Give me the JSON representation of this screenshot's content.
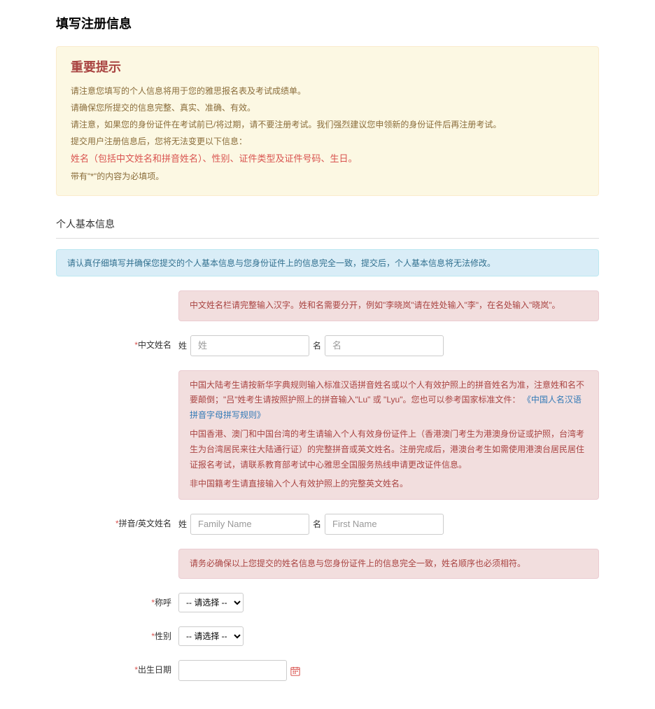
{
  "page": {
    "title": "填写注册信息"
  },
  "important": {
    "title": "重要提示",
    "line1": "请注意您填写的个人信息将用于您的雅思报名表及考试成绩单。",
    "line2": "请确保您所提交的信息完整、真实、准确、有效。",
    "line3": "请注意，如果您的身份证件在考试前已/将过期，请不要注册考试。我们强烈建议您申领新的身份证件后再注册考试。",
    "line4": "提交用户注册信息后，您将无法变更以下信息：",
    "line5": "姓名（包括中文姓名和拼音姓名）、性别、证件类型及证件号码、生日。",
    "line6": "带有\"*\"的内容为必填项。"
  },
  "section": {
    "title": "个人基本信息"
  },
  "info_alert": "请认真仔细填写并确保您提交的个人基本信息与您身份证件上的信息完全一致，提交后，个人基本信息将无法修改。",
  "hints": {
    "chinese_name": "中文姓名栏请完整输入汉字。姓和名需要分开，例如\"李晓岚\"请在姓处输入\"李\"，在名处输入\"晓岚\"。",
    "pinyin_p1_a": "中国大陆考生请按新华字典规则输入标准汉语拼音姓名或以个人有效护照上的拼音姓名为准，注意姓和名不要颠倒；\"吕\"姓考生请按照护照上的拼音输入\"Lu\" 或 \"Lyu\"。您也可以参考国家标准文件：",
    "pinyin_p1_link": "《中国人名汉语拼音字母拼写规则》",
    "pinyin_p2": "中国香港、澳门和中国台湾的考生请输入个人有效身份证件上（香港澳门考生为港澳身份证或护照，台湾考生为台湾居民来往大陆通行证）的完整拼音或英文姓名。注册完成后，港澳台考生如需使用港澳台居民居住证报名考试，请联系教育部考试中心雅思全国服务热线申请更改证件信息。",
    "pinyin_p3": "非中国籍考生请直接输入个人有效护照上的完整英文姓名。",
    "consistency": "请务必确保以上您提交的姓名信息与您身份证件上的信息完全一致，姓名顺序也必须相符。"
  },
  "fields": {
    "chinese_name_label": "中文姓名",
    "family_sub": "姓",
    "given_sub": "名",
    "chinese_family_placeholder": "姓",
    "chinese_given_placeholder": "名",
    "pinyin_name_label": "拼音/英文姓名",
    "pinyin_family_placeholder": "Family Name",
    "pinyin_given_placeholder": "First Name",
    "salutation_label": "称呼",
    "gender_label": "性别",
    "dob_label": "出生日期",
    "select_placeholder": "-- 请选择 --"
  }
}
